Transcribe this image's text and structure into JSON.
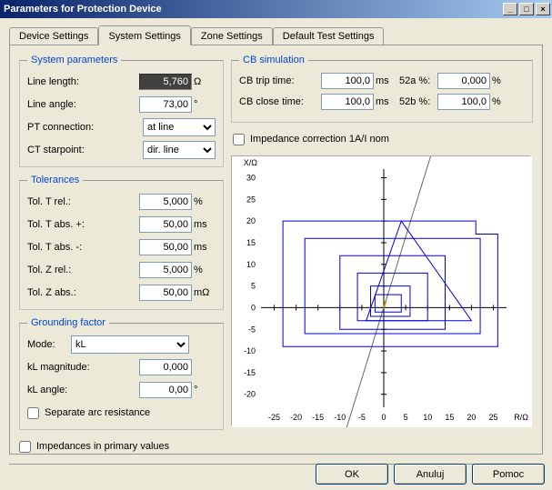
{
  "window": {
    "title": "Parameters for Protection Device"
  },
  "tabs": {
    "device": "Device Settings",
    "system": "System Settings",
    "zone": "Zone Settings",
    "default_test": "Default Test Settings"
  },
  "system_parameters": {
    "legend": "System parameters",
    "line_length_label": "Line length:",
    "line_length_value": "5,760",
    "line_length_unit": "Ω",
    "line_angle_label": "Line angle:",
    "line_angle_value": "73,00",
    "line_angle_unit": "°",
    "pt_connection_label": "PT connection:",
    "pt_connection_value": "at line",
    "ct_starpoint_label": "CT starpoint:",
    "ct_starpoint_value": "dir. line"
  },
  "tolerances": {
    "legend": "Tolerances",
    "t_rel_label": "Tol. T rel.:",
    "t_rel_value": "5,000",
    "t_rel_unit": "%",
    "t_abs_p_label": "Tol. T abs. +:",
    "t_abs_p_value": "50,00",
    "t_abs_p_unit": "ms",
    "t_abs_m_label": "Tol. T abs. -:",
    "t_abs_m_value": "50,00",
    "t_abs_m_unit": "ms",
    "z_rel_label": "Tol. Z rel.:",
    "z_rel_value": "5,000",
    "z_rel_unit": "%",
    "z_abs_label": "Tol. Z abs.:",
    "z_abs_value": "50,00",
    "z_abs_unit": "mΩ"
  },
  "grounding": {
    "legend": "Grounding factor",
    "mode_label": "Mode:",
    "mode_value": "kL",
    "kl_mag_label": "kL magnitude:",
    "kl_mag_value": "0,000",
    "kl_mag_unit": "",
    "kl_angle_label": "kL angle:",
    "kl_angle_value": "0,00",
    "kl_angle_unit": "°",
    "separate_arc_label": "Separate arc resistance"
  },
  "cb_sim": {
    "legend": "CB simulation",
    "trip_label": "CB trip time:",
    "trip_value": "100,0",
    "trip_unit": "ms",
    "a52_label": "52a %:",
    "a52_value": "0,000",
    "a52_unit": "%",
    "close_label": "CB close time:",
    "close_value": "100,0",
    "close_unit": "ms",
    "b52_label": "52b %:",
    "b52_value": "100,0",
    "b52_unit": "%"
  },
  "checkboxes": {
    "impedance_correction": "Impedance correction 1A/I nom",
    "impedances_primary": "Impedances in primary values"
  },
  "chart": {
    "x_label": "R/Ω",
    "y_label": "X/Ω",
    "x_ticks": [
      -25,
      -20,
      -15,
      -10,
      -5,
      0,
      5,
      10,
      15,
      20,
      25
    ],
    "y_ticks": [
      -20,
      -15,
      -10,
      -5,
      0,
      5,
      10,
      15,
      20,
      25,
      30
    ]
  },
  "buttons": {
    "ok": "OK",
    "cancel": "Anuluj",
    "help": "Pomoc"
  }
}
